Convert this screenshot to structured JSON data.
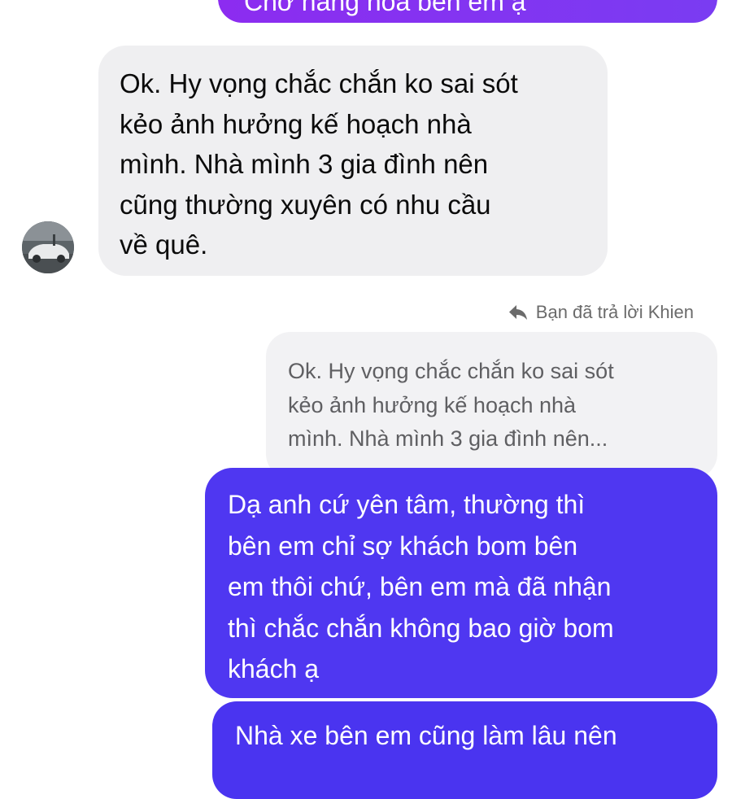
{
  "messages": {
    "top_sent": {
      "text": "Chờ hàng hoá bên em ạ"
    },
    "incoming": {
      "text": "Ok. Hy vọng chắc chắn ko sai sót\nkẻo ảnh hưởng kế hoạch nhà\nmình. Nhà mình 3 gia đình nên\ncũng thường xuyên có nhu cầu\nvề quê."
    },
    "reply_meta": {
      "icon": "reply-icon",
      "label": "Bạn đã trả lời Khien"
    },
    "quoted": {
      "text": "Ok. Hy vọng chắc chắn ko sai sót\nkẻo ảnh hưởng kế hoạch nhà\nmình. Nhà mình 3 gia đình nên..."
    },
    "sent_main": {
      "text": "Dạ anh cứ yên tâm, thường thì\nbên em chỉ sợ khách bom bên\nem thôi chứ, bên em mà đã nhận\nthì chắc chắn không bao giờ bom\nkhách ạ"
    },
    "sent_next": {
      "text": "Nhà xe bên em cũng làm lâu nên"
    }
  },
  "colors": {
    "sent_bubble": "#4f37f1",
    "top_bubble": "#8c2cf0",
    "incoming_bubble": "#efeff1",
    "quoted_bubble": "#f2f2f4",
    "meta_text": "#6b6b6b"
  }
}
